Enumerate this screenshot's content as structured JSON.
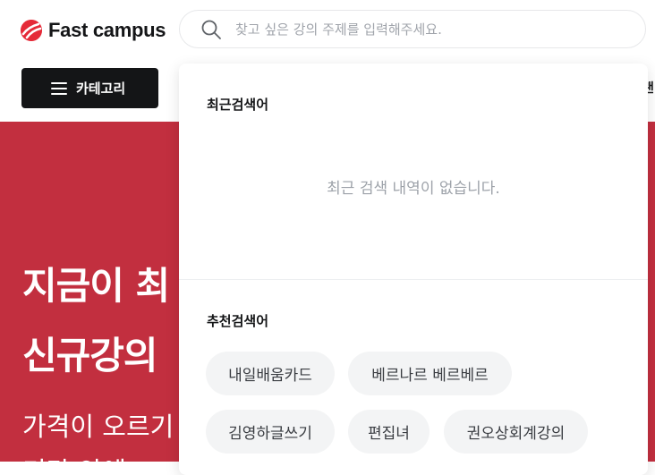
{
  "header": {
    "logo_text": "Fast campus",
    "search_placeholder": "찾고 싶은 강의 주제를 입력해주세요.",
    "category_label": "카테고리",
    "nav_peek": "랜"
  },
  "hero": {
    "title_line1": "지금이 최",
    "title_line2": "신규강의",
    "sub_line1": "가격이 오르기",
    "sub_line2": "기간 안에 ..."
  },
  "dropdown": {
    "recent_title": "최근검색어",
    "recent_empty": "최근 검색 내역이 없습니다.",
    "recommended_title": "추천검색어",
    "recommended": [
      "내일배움카드",
      "베르나르 베르베르",
      "김영하글쓰기",
      "편집녀",
      "권오상회계강의"
    ]
  },
  "colors": {
    "brand": "#e52a38",
    "hero_bg": "#c22f3f",
    "chip_bg": "#f3f4f5"
  }
}
